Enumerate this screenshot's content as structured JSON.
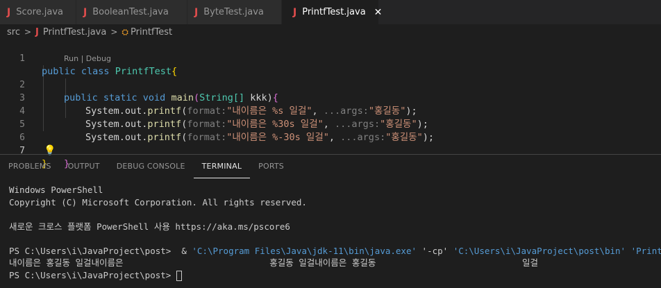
{
  "tabs": [
    {
      "label": "Score.java",
      "icon": "java-file-icon"
    },
    {
      "label": "BooleanTest.java",
      "icon": "java-file-icon"
    },
    {
      "label": "ByteTest.java",
      "icon": "java-file-icon"
    },
    {
      "label": "PrintfTest.java",
      "icon": "java-file-icon",
      "active": true,
      "close": "✕"
    }
  ],
  "breadcrumb": {
    "folder": "src",
    "file": "PrintfTest.java",
    "symbol": "PrintfTest"
  },
  "editor": {
    "line_numbers": [
      "1",
      "2",
      "3",
      "4",
      "5",
      "6",
      "7"
    ],
    "codelens": "Run | Debug",
    "lines": {
      "l1": {
        "kw": "public class",
        "cls": "PrintfTest",
        "brace": "{"
      },
      "l2": {
        "kw1": "public static void",
        "fn": "main",
        "p1": "(",
        "type": "String[]",
        "p2": " kkk)",
        "brace": "{"
      },
      "l3": {
        "obj": "System.out.",
        "fn": "printf",
        "open": "(",
        "hint1": "format:",
        "str": "\"내이름은 %s 일걸\"",
        "comma": ", ",
        "hint2": "...args:",
        "arg": "\"홍길동\"",
        "close": ");"
      },
      "l4": {
        "obj": "System.out.",
        "fn": "printf",
        "open": "(",
        "hint1": "format:",
        "str": "\"내이름은 %30s 일걸\"",
        "comma": ", ",
        "hint2": "...args:",
        "arg": "\"홍길동\"",
        "close": ");"
      },
      "l5": {
        "obj": "System.out.",
        "fn": "printf",
        "open": "(",
        "hint1": "format:",
        "str": "\"내이름은 %-30s 일걸\"",
        "comma": ", ",
        "hint2": "...args:",
        "arg": "\"홍길동\"",
        "close": ");"
      },
      "l6": {
        "brace": "}"
      },
      "l7": {
        "brace": "}"
      }
    }
  },
  "panel": {
    "tabs": [
      "PROBLEMS",
      "OUTPUT",
      "DEBUG CONSOLE",
      "TERMINAL",
      "PORTS"
    ],
    "active_tab": "TERMINAL"
  },
  "terminal": {
    "line1": "Windows PowerShell",
    "line2": "Copyright (C) Microsoft Corporation. All rights reserved.",
    "line3": "새로운 크로스 플랫폼 PowerShell 사용 https://aka.ms/pscore6",
    "prompt1": "PS C:\\Users\\i\\JavaProject\\post> ",
    "cmd_amp": " & ",
    "cmd_java": "'C:\\Program Files\\Java\\jdk-11\\bin\\java.exe'",
    "cmd_cp": " '-cp' ",
    "cmd_path": "'C:\\Users\\i\\JavaProject\\post\\bin'",
    "cmd_sp": " ",
    "cmd_class": "'PrintfTest'",
    "output": "내이름은 홍길동 일걸내이름은                            홍길동 일걸내이름은 홍길동                            일걸",
    "prompt2": "PS C:\\Users\\i\\JavaProject\\post> "
  },
  "colors": {
    "keyword": "#569cd6",
    "class": "#4ec9b0",
    "function": "#dcdcaa",
    "string": "#ce9178",
    "java_icon": "#e24d4d"
  }
}
